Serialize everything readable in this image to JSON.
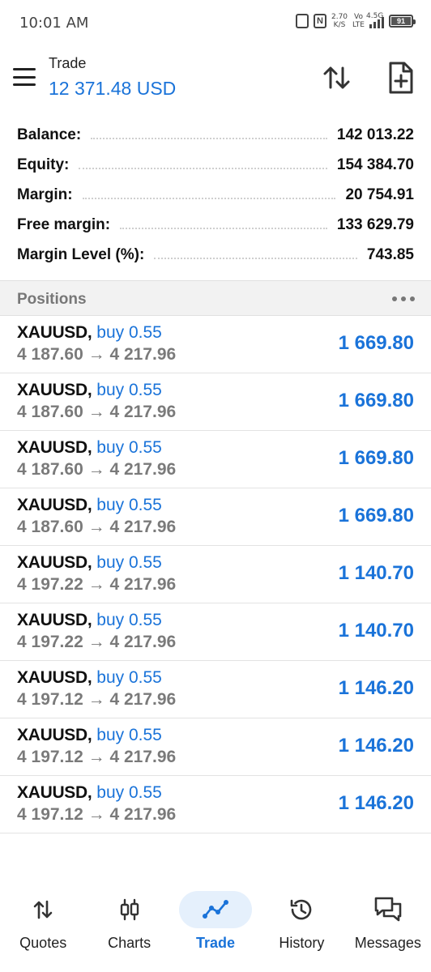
{
  "status_bar": {
    "time": "10:01 AM",
    "speed_value": "2.70",
    "speed_unit": "K/S",
    "volte_top": "Vo",
    "volte_bottom": "LTE",
    "network": "4.5G",
    "battery": "91"
  },
  "header": {
    "title": "Trade",
    "balance": "12 371.48 USD"
  },
  "summary": [
    {
      "label": "Balance:",
      "value": "142 013.22"
    },
    {
      "label": "Equity:",
      "value": "154 384.70"
    },
    {
      "label": "Margin:",
      "value": "20 754.91"
    },
    {
      "label": "Free margin:",
      "value": "133 629.79"
    },
    {
      "label": "Margin Level (%):",
      "value": "743.85"
    }
  ],
  "positions_header": {
    "label": "Positions"
  },
  "positions": [
    {
      "symbol": "XAUUSD,",
      "side": "buy 0.55",
      "open": "4 187.60",
      "arrow": "→",
      "current": "4 217.96",
      "profit": "1 669.80"
    },
    {
      "symbol": "XAUUSD,",
      "side": "buy 0.55",
      "open": "4 187.60",
      "arrow": "→",
      "current": "4 217.96",
      "profit": "1 669.80"
    },
    {
      "symbol": "XAUUSD,",
      "side": "buy 0.55",
      "open": "4 187.60",
      "arrow": "→",
      "current": "4 217.96",
      "profit": "1 669.80"
    },
    {
      "symbol": "XAUUSD,",
      "side": "buy 0.55",
      "open": "4 187.60",
      "arrow": "→",
      "current": "4 217.96",
      "profit": "1 669.80"
    },
    {
      "symbol": "XAUUSD,",
      "side": "buy 0.55",
      "open": "4 197.22",
      "arrow": "→",
      "current": "4 217.96",
      "profit": "1 140.70"
    },
    {
      "symbol": "XAUUSD,",
      "side": "buy 0.55",
      "open": "4 197.22",
      "arrow": "→",
      "current": "4 217.96",
      "profit": "1 140.70"
    },
    {
      "symbol": "XAUUSD,",
      "side": "buy 0.55",
      "open": "4 197.12",
      "arrow": "→",
      "current": "4 217.96",
      "profit": "1 146.20"
    },
    {
      "symbol": "XAUUSD,",
      "side": "buy 0.55",
      "open": "4 197.12",
      "arrow": "→",
      "current": "4 217.96",
      "profit": "1 146.20"
    },
    {
      "symbol": "XAUUSD,",
      "side": "buy 0.55",
      "open": "4 197.12",
      "arrow": "→",
      "current": "4 217.96",
      "profit": "1 146.20"
    }
  ],
  "bottom_nav": [
    {
      "label": "Quotes",
      "icon": "quotes-icon",
      "active": false
    },
    {
      "label": "Charts",
      "icon": "charts-icon",
      "active": false
    },
    {
      "label": "Trade",
      "icon": "trade-icon",
      "active": true
    },
    {
      "label": "History",
      "icon": "history-icon",
      "active": false
    },
    {
      "label": "Messages",
      "icon": "messages-icon",
      "active": false
    }
  ],
  "colors": {
    "accent": "#1a73d9",
    "active_nav_bg": "#e5f0fc",
    "section_bg": "#f2f2f2"
  }
}
